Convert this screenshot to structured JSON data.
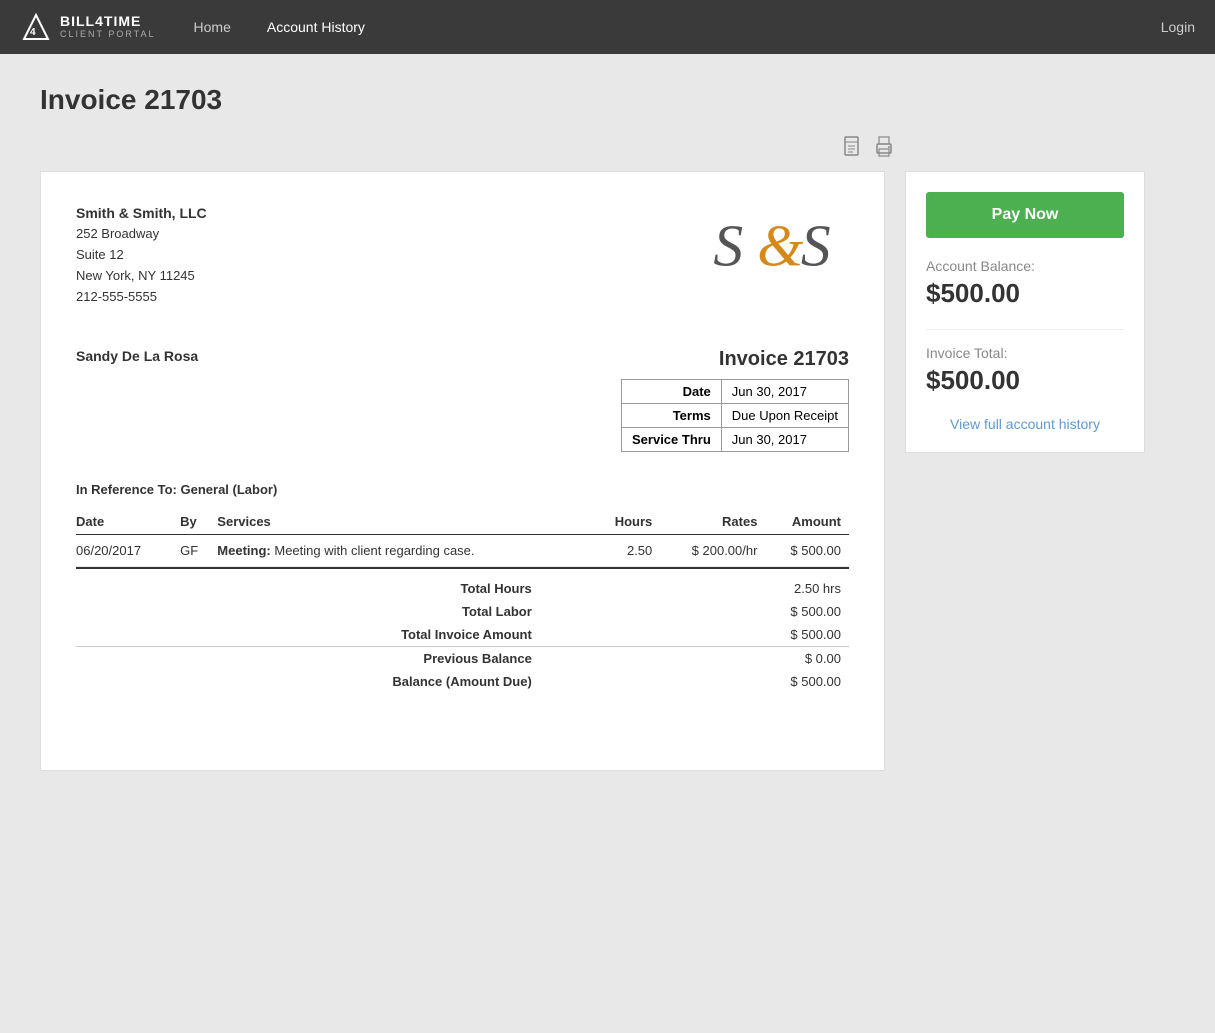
{
  "navbar": {
    "brand_name": "BILL4TIME",
    "brand_sub": "CLIENT PORTAL",
    "links": [
      {
        "label": "Home",
        "active": false
      },
      {
        "label": "Account History",
        "active": true
      }
    ],
    "login_label": "Login"
  },
  "page": {
    "title": "Invoice 21703"
  },
  "toolbar": {
    "pdf_icon": "📄",
    "print_icon": "🖨"
  },
  "invoice": {
    "company": {
      "name": "Smith & Smith, LLC",
      "address1": "252 Broadway",
      "address2": "Suite 12",
      "city_state_zip": "New York, NY 11245",
      "phone": "212-555-5555"
    },
    "client_name": "Sandy De La Rosa",
    "invoice_number": "Invoice 21703",
    "meta": [
      {
        "label": "Date",
        "value": "Jun 30, 2017"
      },
      {
        "label": "Terms",
        "value": "Due Upon Receipt"
      },
      {
        "label": "Service Thru",
        "value": "Jun 30, 2017"
      }
    ],
    "reference": "In Reference To: General (Labor)",
    "columns": {
      "date": "Date",
      "by": "By",
      "services": "Services",
      "hours": "Hours",
      "rates": "Rates",
      "amount": "Amount"
    },
    "line_items": [
      {
        "date": "06/20/2017",
        "by": "GF",
        "service_bold": "Meeting:",
        "service_desc": " Meeting with client regarding case.",
        "hours": "2.50",
        "rate": "$ 200.00/hr",
        "amount": "$ 500.00"
      }
    ],
    "totals": [
      {
        "label": "Total Hours",
        "value": "2.50 hrs"
      },
      {
        "label": "Total Labor",
        "value": "$ 500.00"
      },
      {
        "label": "Total Invoice Amount",
        "value": "$ 500.00"
      },
      {
        "label": "Previous Balance",
        "value": "$ 0.00"
      },
      {
        "label": "Balance (Amount Due)",
        "value": "$ 500.00"
      }
    ]
  },
  "sidebar": {
    "pay_now_label": "Pay Now",
    "account_balance_label": "Account Balance:",
    "account_balance": "$500.00",
    "invoice_total_label": "Invoice Total:",
    "invoice_total": "$500.00",
    "view_history_label": "View full account history"
  }
}
